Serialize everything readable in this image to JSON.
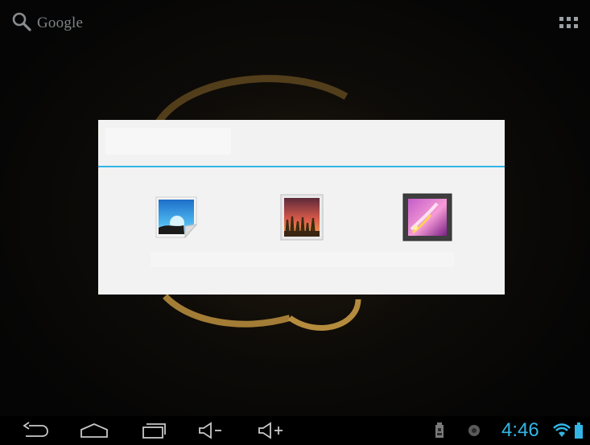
{
  "search": {
    "label": "Google"
  },
  "dialog": {
    "title": "",
    "options": [
      {
        "icon": "gallery-picture-icon",
        "label": ""
      },
      {
        "icon": "wallpapers-icon",
        "label": ""
      },
      {
        "icon": "live-wallpapers-icon",
        "label": ""
      }
    ]
  },
  "status": {
    "time": "4:46"
  },
  "colors": {
    "accent": "#33b5e5",
    "dialog_bg": "#f2f2f2",
    "navbar_bg": "#000000"
  }
}
